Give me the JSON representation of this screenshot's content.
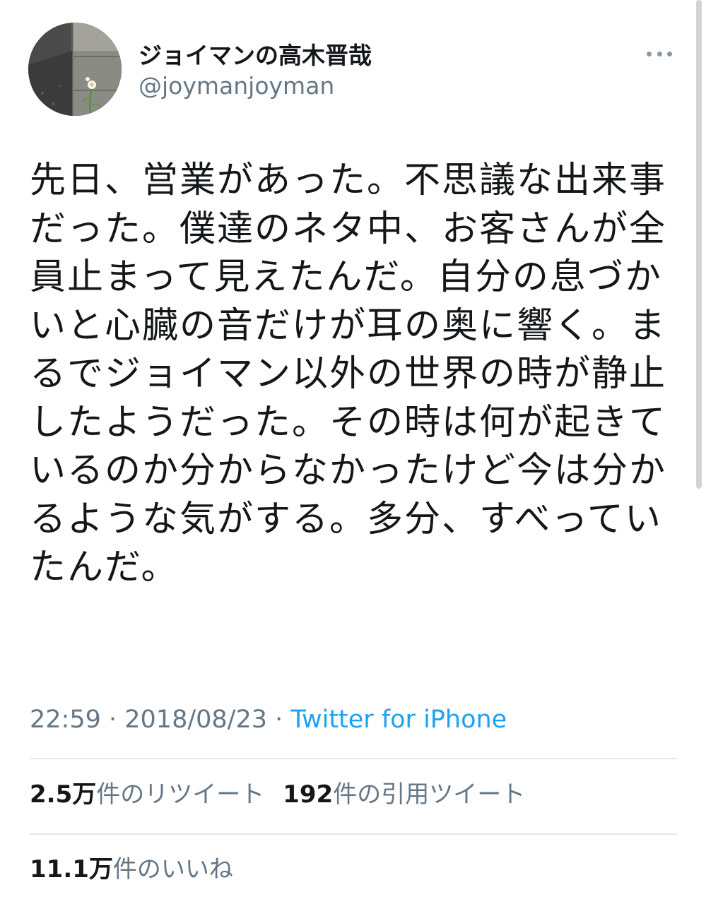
{
  "user": {
    "display_name": "ジョイマンの高木晋哉",
    "handle": "@joymanjoyman",
    "avatar_icon": "profile-photo-flower-roadside"
  },
  "tweet": {
    "text": "先日、営業があった。不思議な出来事だった。僕達のネタ中、お客さんが全員止まって見えたんだ。自分の息づかいと心臓の音だけが耳の奥に響く。まるでジョイマン以外の世界の時が静止したようだった。その時は何が起きているのか分からなかったけど今は分かるような気がする。多分、すべっていたんだ。",
    "time": "22:59",
    "separator": " · ",
    "date": "2018/08/23",
    "source": "Twitter for iPhone"
  },
  "stats": {
    "retweets_count": "2.5万",
    "retweets_label": "件のリツイート",
    "quotes_count": "192",
    "quotes_label": "件の引用ツイート",
    "likes_count": "11.1万",
    "likes_label": "件のいいね"
  },
  "colors": {
    "text": "#14171a",
    "secondary": "#657786",
    "link": "#1da1f2",
    "divider": "#e1e8ed"
  }
}
